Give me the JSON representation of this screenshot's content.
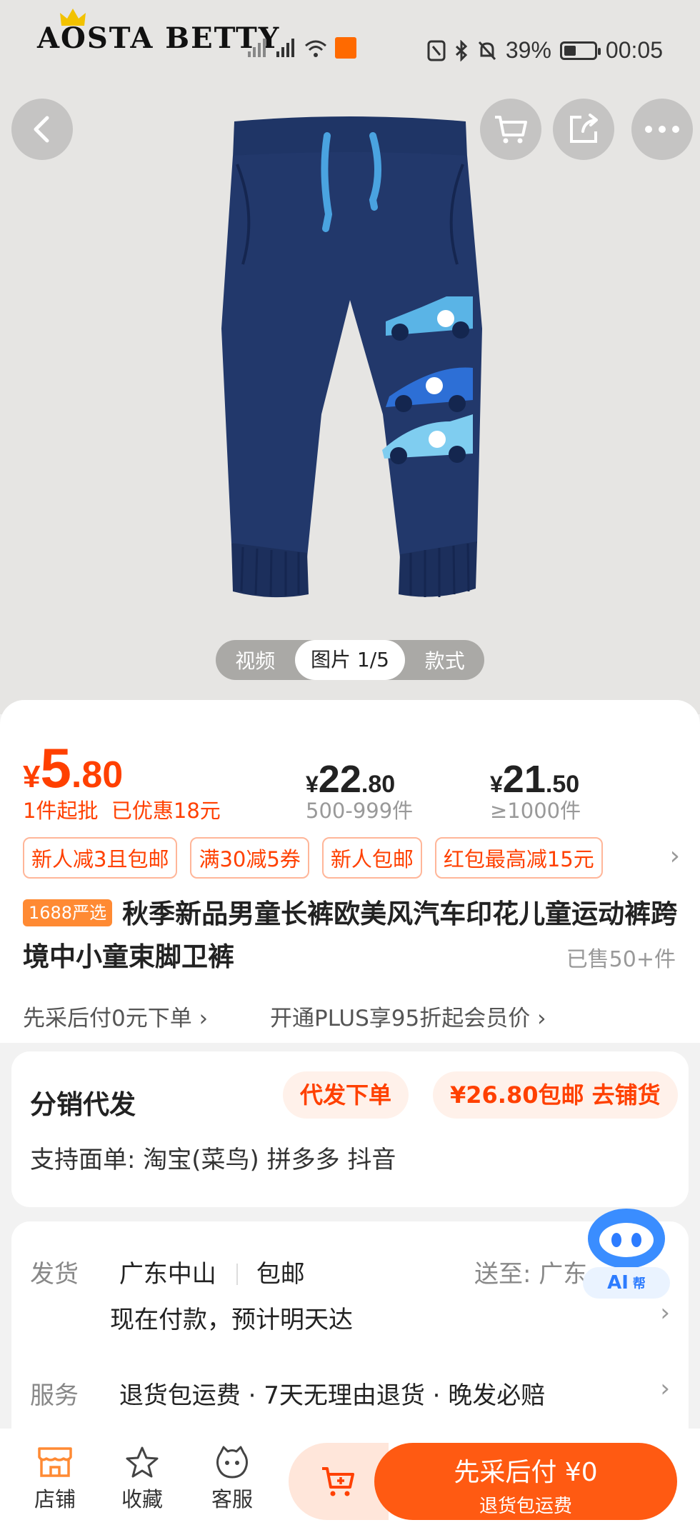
{
  "status": {
    "brand": "AOSTA BETTY",
    "battery": "39%",
    "time": "00:05"
  },
  "media_tabs": {
    "video": "视频",
    "image": "图片 1/5",
    "style": "款式"
  },
  "price": {
    "currency": "¥",
    "main_int": "5",
    "main_dec": ".80",
    "min_order": "1件起批",
    "discount": "已优惠18元",
    "tiers": [
      {
        "int": "22",
        "dec": ".80",
        "qty": "500-999件"
      },
      {
        "int": "21",
        "dec": ".50",
        "qty": "≥1000件"
      }
    ]
  },
  "coupons": [
    "新人减3且包邮",
    "满30减5券",
    "新人包邮",
    "红包最高减15元"
  ],
  "product": {
    "badge": "1688严选",
    "title": "秋季新品男童长裤欧美风汽车印花儿童运动裤跨境中小童束脚卫裤",
    "sold": "已售50+件"
  },
  "perks": {
    "pay_later": "先采后付0元下单",
    "plus": "开通PLUS享95折起会员价"
  },
  "distribution": {
    "title": "分销代发",
    "order_btn": "代发下单",
    "shop_btn": "¥26.80包邮 去铺货",
    "support": "支持面单: 淘宝(菜鸟) 拼多多 抖音"
  },
  "shipping": {
    "label": "发货",
    "origin": "广东中山",
    "free": "包邮",
    "to_label": "送至:",
    "to_value": "广东",
    "eta": "现在付款，预计明天达",
    "service_label": "服务",
    "services": "退货包运费 · 7天无理由退货 · 晚发必赔"
  },
  "ai": {
    "label": "AI",
    "sub": "帮"
  },
  "bottom": {
    "store": "店铺",
    "favorite": "收藏",
    "service": "客服",
    "buy_main": "先采后付 ¥0",
    "buy_sub": "退货包运费"
  },
  "colors": {
    "accent": "#ff4000",
    "button": "#ff5a12",
    "pants": "#1f3566",
    "drawstring": "#4aa3e0"
  }
}
